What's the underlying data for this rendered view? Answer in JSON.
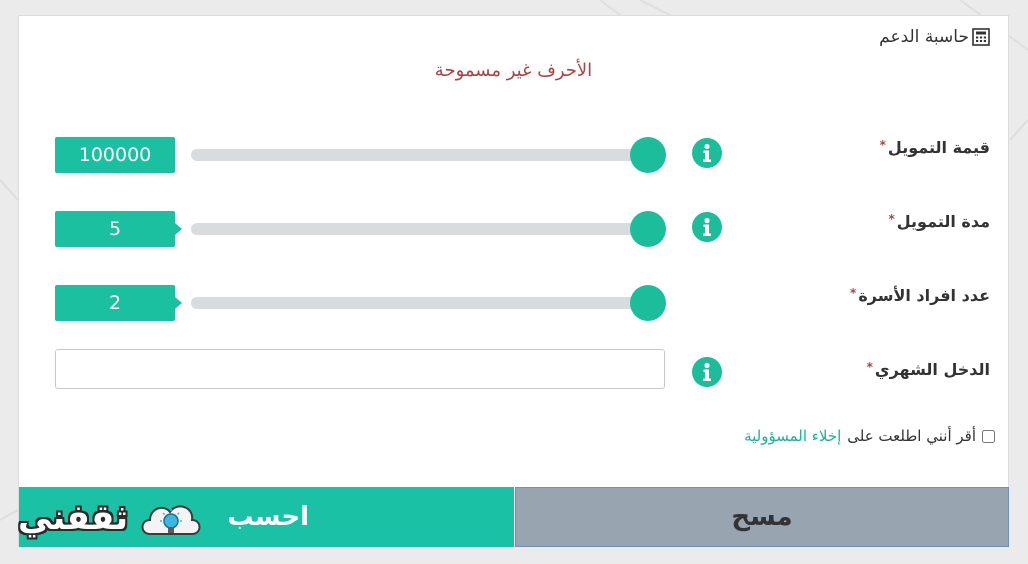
{
  "card": {
    "title": "حاسبة الدعم",
    "title_icon": "calculator-icon",
    "warning": "الأحرف غير مسموحة",
    "warning_color": "#a94442"
  },
  "fields": [
    {
      "label": "قيمة التمويل",
      "required_mark": "*",
      "value": "100000",
      "slider_level": 1.0,
      "has_info": true
    },
    {
      "label": "مدة التمويل",
      "required_mark": "*",
      "value": "5",
      "slider_level": 1.0,
      "has_info": true
    },
    {
      "label": "عدد افراد الأسرة",
      "required_mark": "*",
      "value": "2",
      "slider_level": 1.0,
      "has_info": false
    },
    {
      "label": "الدخل الشهري",
      "required_mark": "*",
      "value": "",
      "placeholder": "",
      "has_info": true
    }
  ],
  "consent": {
    "text": "أقر أنني اطلعت على",
    "link": "إخلاء المسؤولية",
    "checked": false
  },
  "buttons": {
    "calculate": "احسب",
    "clear": "مسح"
  },
  "logo": {
    "text": "ثقفني",
    "icon": "lightbulb-cloud-icon"
  },
  "colors": {
    "accent": "#1bc0a0",
    "slider_track": "#d9dcde",
    "clear_button": "#98a4b0",
    "required": "#a94442"
  }
}
